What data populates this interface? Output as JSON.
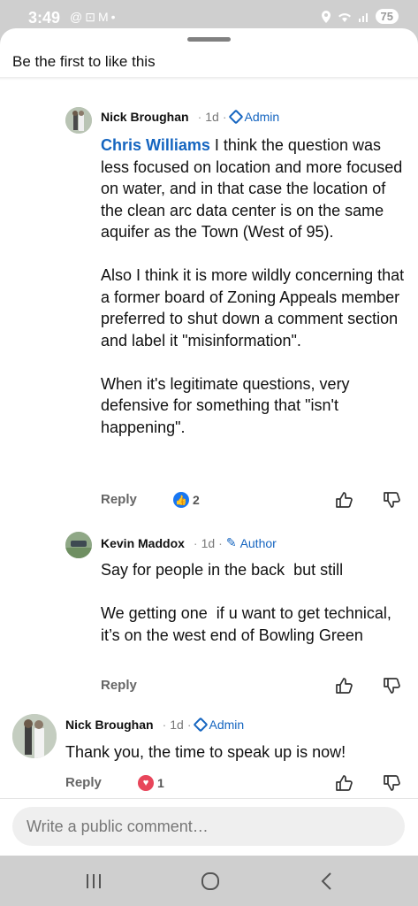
{
  "status_bar": {
    "time": "3:49",
    "left_icons": [
      "at-sign-icon",
      "screenshot-icon",
      "gmail-icon",
      "dot-icon"
    ],
    "right_icons": [
      "location-icon",
      "wifi-icon",
      "signal-icon"
    ],
    "battery": "75"
  },
  "sheet": {
    "likes_text": "Be the first to like this"
  },
  "comments": [
    {
      "author": "Nick Broughan",
      "time": "1d",
      "badge": "Admin",
      "badge_icon": "admin-diamond-icon",
      "mention": "Chris Williams",
      "text": " I think the question was less focused on location and more focused on water, and in that case the location of the clean arc data center is on the same aquifer as the Town (West of 95).\n\nAlso I think it is more wildly concerning that a former board of Zoning Appeals member preferred to shut down a comment section and label it \"misinformation\".\n\nWhen it's legitimate questions, very defensive for something that \"isn't happening\".",
      "reply_label": "Reply",
      "reaction_type": "like",
      "reaction_count": "2"
    },
    {
      "author": "Kevin Maddox",
      "time": "1d",
      "badge": "Author",
      "badge_icon": "pencil-icon",
      "text": "Say for people in the back  but still\n\nWe getting one  if u want to get technical, it’s on the west end of Bowling Green",
      "reply_label": "Reply"
    },
    {
      "author": "Nick Broughan",
      "time": "1d",
      "badge": "Admin",
      "badge_icon": "admin-diamond-icon",
      "text": "Thank you, the time to speak up is now!",
      "reply_label": "Reply",
      "reaction_type": "love",
      "reaction_count": "1"
    }
  ],
  "composer": {
    "placeholder": "Write a public comment…"
  },
  "nav": [
    "recent-apps-icon",
    "home-icon",
    "back-icon"
  ]
}
